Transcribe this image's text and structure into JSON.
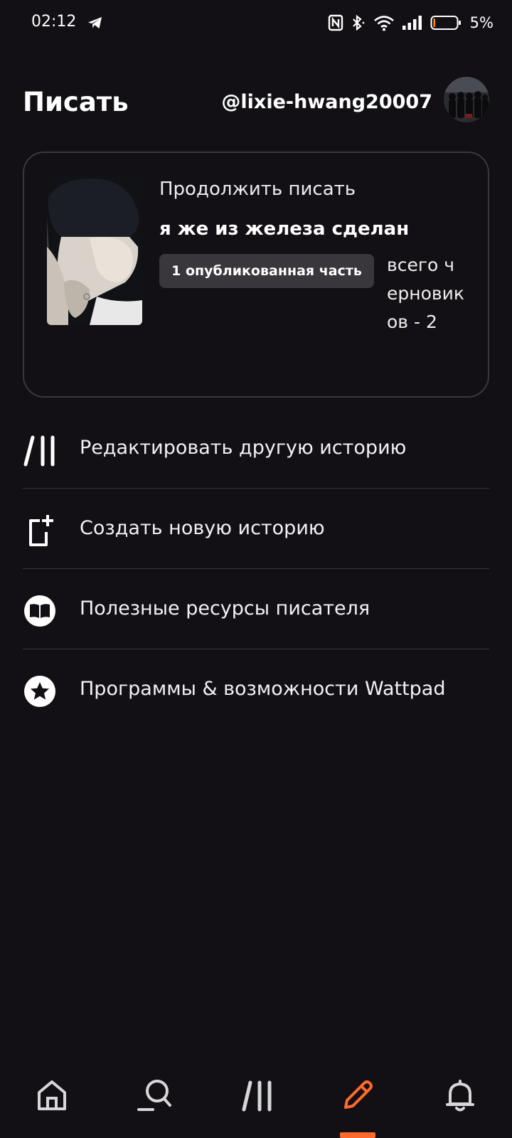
{
  "status_bar": {
    "time": "02:12",
    "battery_percent": "5%",
    "icons": [
      "telegram-icon",
      "nfc-icon",
      "bluetooth-icon",
      "wifi-icon",
      "signal-icon",
      "battery-icon"
    ]
  },
  "header": {
    "title": "Писать",
    "username": "@lixie-hwang20007"
  },
  "continue_card": {
    "label": "Продолжить писать",
    "story_title": "я же из железа сделан",
    "published_badge": "1 опубликованная часть",
    "drafts_text": "всего черновиков - 2"
  },
  "menu": {
    "items": [
      {
        "label": "Редактировать другую историю",
        "icon": "library-slash-icon"
      },
      {
        "label": "Создать новую историю",
        "icon": "new-story-icon"
      },
      {
        "label": "Полезные ресурсы писателя",
        "icon": "book-icon"
      },
      {
        "label": "Программы & возможности Wattpad",
        "icon": "star-icon"
      }
    ]
  },
  "bottom_nav": {
    "items": [
      "home-icon",
      "search-icon",
      "library-icon",
      "write-icon",
      "notifications-icon"
    ],
    "active": "write-icon"
  },
  "colors": {
    "background": "#121014",
    "accent": "#ff6a2c",
    "card_border": "#3a383c",
    "badge_bg": "#39373b",
    "divider": "#38363a"
  }
}
